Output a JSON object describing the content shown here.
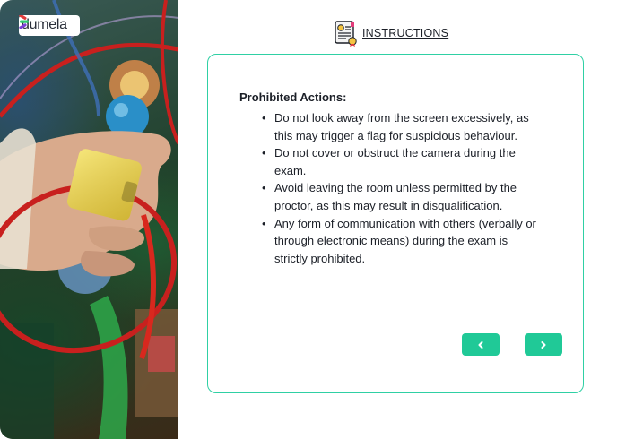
{
  "brand": {
    "name": "dumela",
    "accent": "#20c997",
    "card_border": "#2fd0a4"
  },
  "header": {
    "title": "INSTRUCTIONS",
    "icon": "certificate-document-icon"
  },
  "instructions": {
    "section_title": "Prohibited Actions:",
    "items": [
      {
        "text": "Do not look away from the screen excessively, as this may trigger a flag for suspicious behaviour."
      },
      {
        "text": "Do not cover or obstruct the camera during the exam."
      },
      {
        "text": "Avoid leaving the room unless permitted by the proctor, as this may result in disqualification."
      },
      {
        "text": "Any form of communication with others (verbally or through electronic means) during the exam is strictly prohibited."
      }
    ]
  },
  "navigation": {
    "prev_icon": "chevron-left-icon",
    "next_icon": "chevron-right-icon"
  }
}
